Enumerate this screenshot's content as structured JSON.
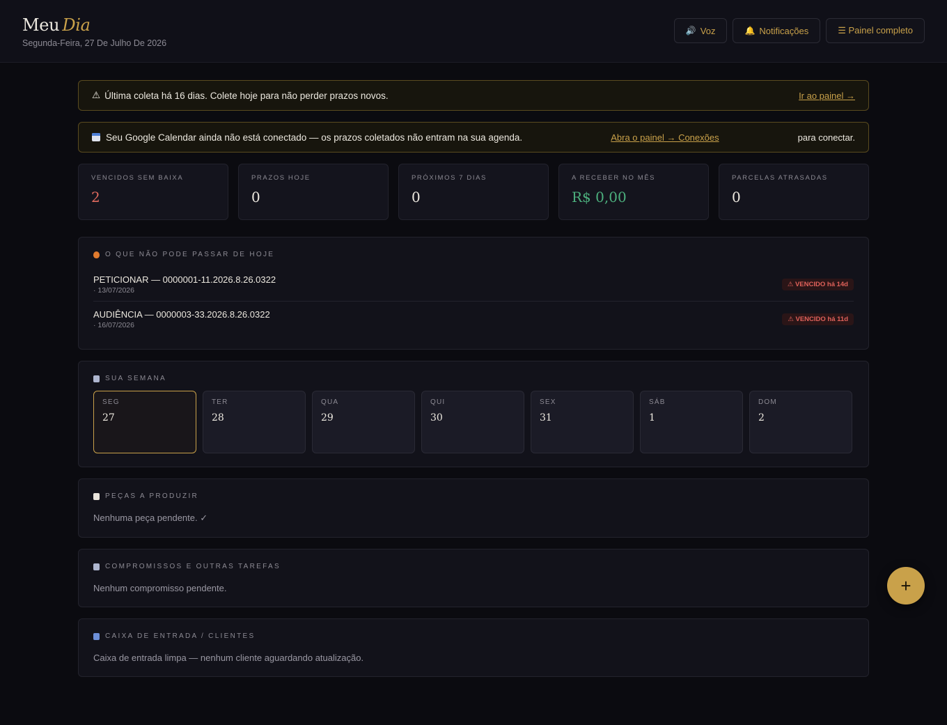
{
  "header": {
    "title_main": "Meu",
    "title_accent": "Dia",
    "date": "Segunda-Feira, 27 De Julho De 2026",
    "buttons": {
      "voice": "Voz",
      "notifications": "Notificações",
      "full_panel": "☰ Painel completo"
    }
  },
  "alerts": {
    "last_collect": {
      "icon": "⚠",
      "text": "Última coleta há 16 dias. Colete hoje para não perder prazos novos.",
      "link": "Ir ao painel →"
    },
    "calendar": {
      "text": "Seu Google Calendar ainda não está conectado — os prazos coletados não entram na sua agenda.",
      "link": "Abra o painel → Conexões",
      "tail": "para conectar."
    }
  },
  "stats": [
    {
      "label": "VENCIDOS SEM BAIXA",
      "value": "2"
    },
    {
      "label": "PRAZOS HOJE",
      "value": "0"
    },
    {
      "label": "PRÓXIMOS 7 DIAS",
      "value": "0"
    },
    {
      "label": "A RECEBER NO MÊS",
      "value": "R$ 0,00"
    },
    {
      "label": "PARCELAS ATRASADAS",
      "value": "0"
    }
  ],
  "urgent": {
    "title": "O QUE NÃO PODE PASSAR DE HOJE",
    "items": [
      {
        "title": "PETICIONAR — 0000001-11.2026.8.26.0322",
        "date": "· 13/07/2026",
        "badge": "⚠ VENCIDO há 14d"
      },
      {
        "title": "AUDIÊNCIA — 0000003-33.2026.8.26.0322",
        "date": "· 16/07/2026",
        "badge": "⚠ VENCIDO há 11d"
      }
    ]
  },
  "week": {
    "title": "SUA SEMANA",
    "days": [
      {
        "label": "SEG",
        "num": "27"
      },
      {
        "label": "TER",
        "num": "28"
      },
      {
        "label": "QUA",
        "num": "29"
      },
      {
        "label": "QUI",
        "num": "30"
      },
      {
        "label": "SEX",
        "num": "31"
      },
      {
        "label": "SÁB",
        "num": "1"
      },
      {
        "label": "DOM",
        "num": "2"
      }
    ]
  },
  "pieces": {
    "title": "PEÇAS A PRODUZIR",
    "empty": "Nenhuma peça pendente. ✓"
  },
  "appointments": {
    "title": "COMPROMISSOS E OUTRAS TAREFAS",
    "empty": "Nenhum compromisso pendente."
  },
  "inbox": {
    "title": "CAIXA DE ENTRADA / CLIENTES",
    "empty": "Caixa de entrada limpa — nenhum cliente aguardando atualização."
  },
  "fab": {
    "label": "+"
  },
  "colors": {
    "accent": "#c9a14a",
    "danger": "#e06a5e",
    "success": "#4caf7d",
    "background": "#0b0b10"
  }
}
